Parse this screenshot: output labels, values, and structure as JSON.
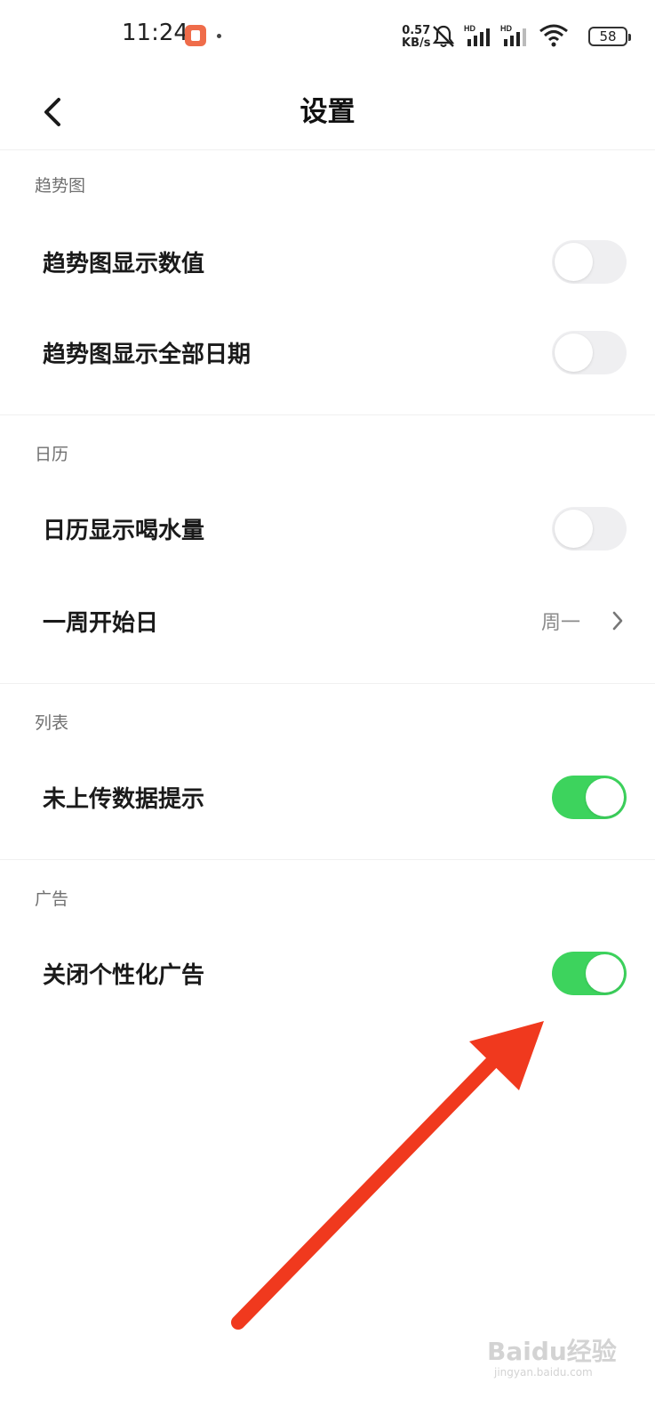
{
  "status_bar": {
    "time": "11:24",
    "net_speed_value": "0.57",
    "net_speed_unit": "KB/s",
    "battery": "58",
    "icons": [
      "app-notification-icon",
      "mute-icon",
      "signal-hd-icon",
      "signal-hd-icon",
      "wifi-icon",
      "battery-icon"
    ]
  },
  "nav": {
    "title": "设置",
    "back_icon": "chevron-left-icon"
  },
  "sections": [
    {
      "header": "趋势图",
      "rows": [
        {
          "label": "趋势图显示数值",
          "type": "toggle",
          "on": false
        },
        {
          "label": "趋势图显示全部日期",
          "type": "toggle",
          "on": false
        }
      ]
    },
    {
      "header": "日历",
      "rows": [
        {
          "label": "日历显示喝水量",
          "type": "toggle",
          "on": false
        },
        {
          "label": "一周开始日",
          "type": "select",
          "value": "周一"
        }
      ]
    },
    {
      "header": "列表",
      "rows": [
        {
          "label": "未上传数据提示",
          "type": "toggle",
          "on": true
        }
      ]
    },
    {
      "header": "广告",
      "rows": [
        {
          "label": "关闭个性化广告",
          "type": "toggle",
          "on": true
        }
      ]
    }
  ],
  "colors": {
    "toggle_on": "#3dd35d",
    "toggle_off": "#efeff1",
    "annotation_arrow": "#f0391e"
  },
  "watermark": {
    "text": "Baidu经验",
    "sub": "jingyan.baidu.com"
  }
}
